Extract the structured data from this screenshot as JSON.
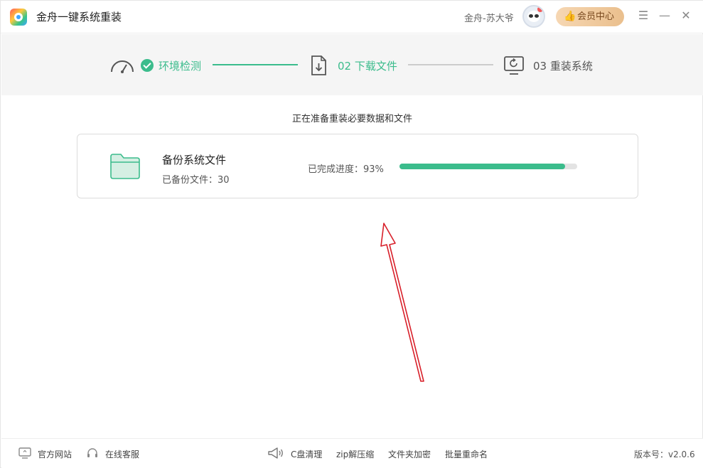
{
  "app": {
    "title": "金舟一键系统重装"
  },
  "header": {
    "user_name": "金舟-苏大爷",
    "vip_label": "会员中心",
    "vip_icon": "thumbs-up-icon"
  },
  "steps": [
    {
      "label": "环境检测",
      "state": "done"
    },
    {
      "label": "02 下载文件",
      "state": "active"
    },
    {
      "label": "03 重装系统",
      "state": "pending"
    }
  ],
  "main": {
    "status_text": "正在准备重装必要数据和文件",
    "task": {
      "title": "备份系统文件",
      "subtitle": "已备份文件：30",
      "progress_label": "已完成进度：93%",
      "progress_percent": 93
    }
  },
  "footer": {
    "site_link": "官方网站",
    "service_link": "在线客服",
    "tools": [
      "C盘清理",
      "zip解压缩",
      "文件夹加密",
      "批量重命名"
    ],
    "version": "版本号：v2.0.6"
  },
  "colors": {
    "accent": "#3bbc8c",
    "vip_gradient_start": "#f6d7b3",
    "vip_gradient_end": "#eabf8d",
    "annotation_arrow": "#d8202a"
  }
}
